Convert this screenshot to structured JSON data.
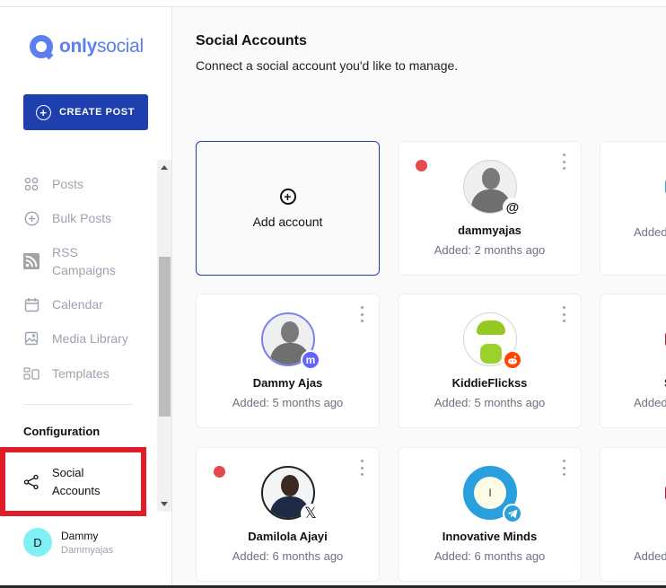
{
  "brand": {
    "name_bold": "only",
    "name_light": "social",
    "color": "#5b7ef0"
  },
  "sidebar": {
    "create_post_label": "CREATE POST",
    "nav": [
      {
        "label": "Posts",
        "icon": "grid-icon"
      },
      {
        "label": "Bulk Posts",
        "icon": "plus-circle-icon"
      },
      {
        "label_line1": "RSS",
        "label_line2": "Campaigns",
        "icon": "rss-icon"
      },
      {
        "label": "Calendar",
        "icon": "calendar-icon"
      },
      {
        "label": "Media Library",
        "icon": "image-icon"
      },
      {
        "label": "Templates",
        "icon": "templates-icon"
      }
    ],
    "section_title": "Configuration",
    "active_item": {
      "label_line1": "Social",
      "label_line2": "Accounts",
      "icon": "share-icon"
    },
    "user": {
      "initial": "D",
      "name": "Dammy",
      "handle": "Dammyajas"
    }
  },
  "main": {
    "title": "Social Accounts",
    "subtitle": "Connect a social account you'd like to manage.",
    "add_account_label": "Add account",
    "accounts": [
      {
        "name": "dammyajas",
        "added": "Added: 2 months ago",
        "platform": "threads",
        "status_dot": true
      },
      {
        "name": "",
        "added": "Added",
        "platform": "partial",
        "status_dot": false
      },
      {
        "name": "Dammy Ajas",
        "added": "Added: 5 months ago",
        "platform": "mastodon",
        "status_dot": false
      },
      {
        "name": "KiddieFlickss",
        "added": "Added: 5 months ago",
        "platform": "reddit",
        "status_dot": false
      },
      {
        "name": "S",
        "added": "Added",
        "platform": "partial",
        "status_dot": false
      },
      {
        "name": "Damilola Ajayi",
        "added": "Added: 6 months ago",
        "platform": "x",
        "status_dot": true
      },
      {
        "name": "Innovative Minds",
        "added": "Added: 6 months ago",
        "platform": "telegram",
        "status_dot": false,
        "avatar_letter": "I"
      },
      {
        "name": "",
        "added": "Added",
        "platform": "partial",
        "status_dot": false
      }
    ]
  },
  "colors": {
    "primary": "#1e40af",
    "status_red": "#e5484d",
    "highlight_box": "#e11d2a"
  }
}
